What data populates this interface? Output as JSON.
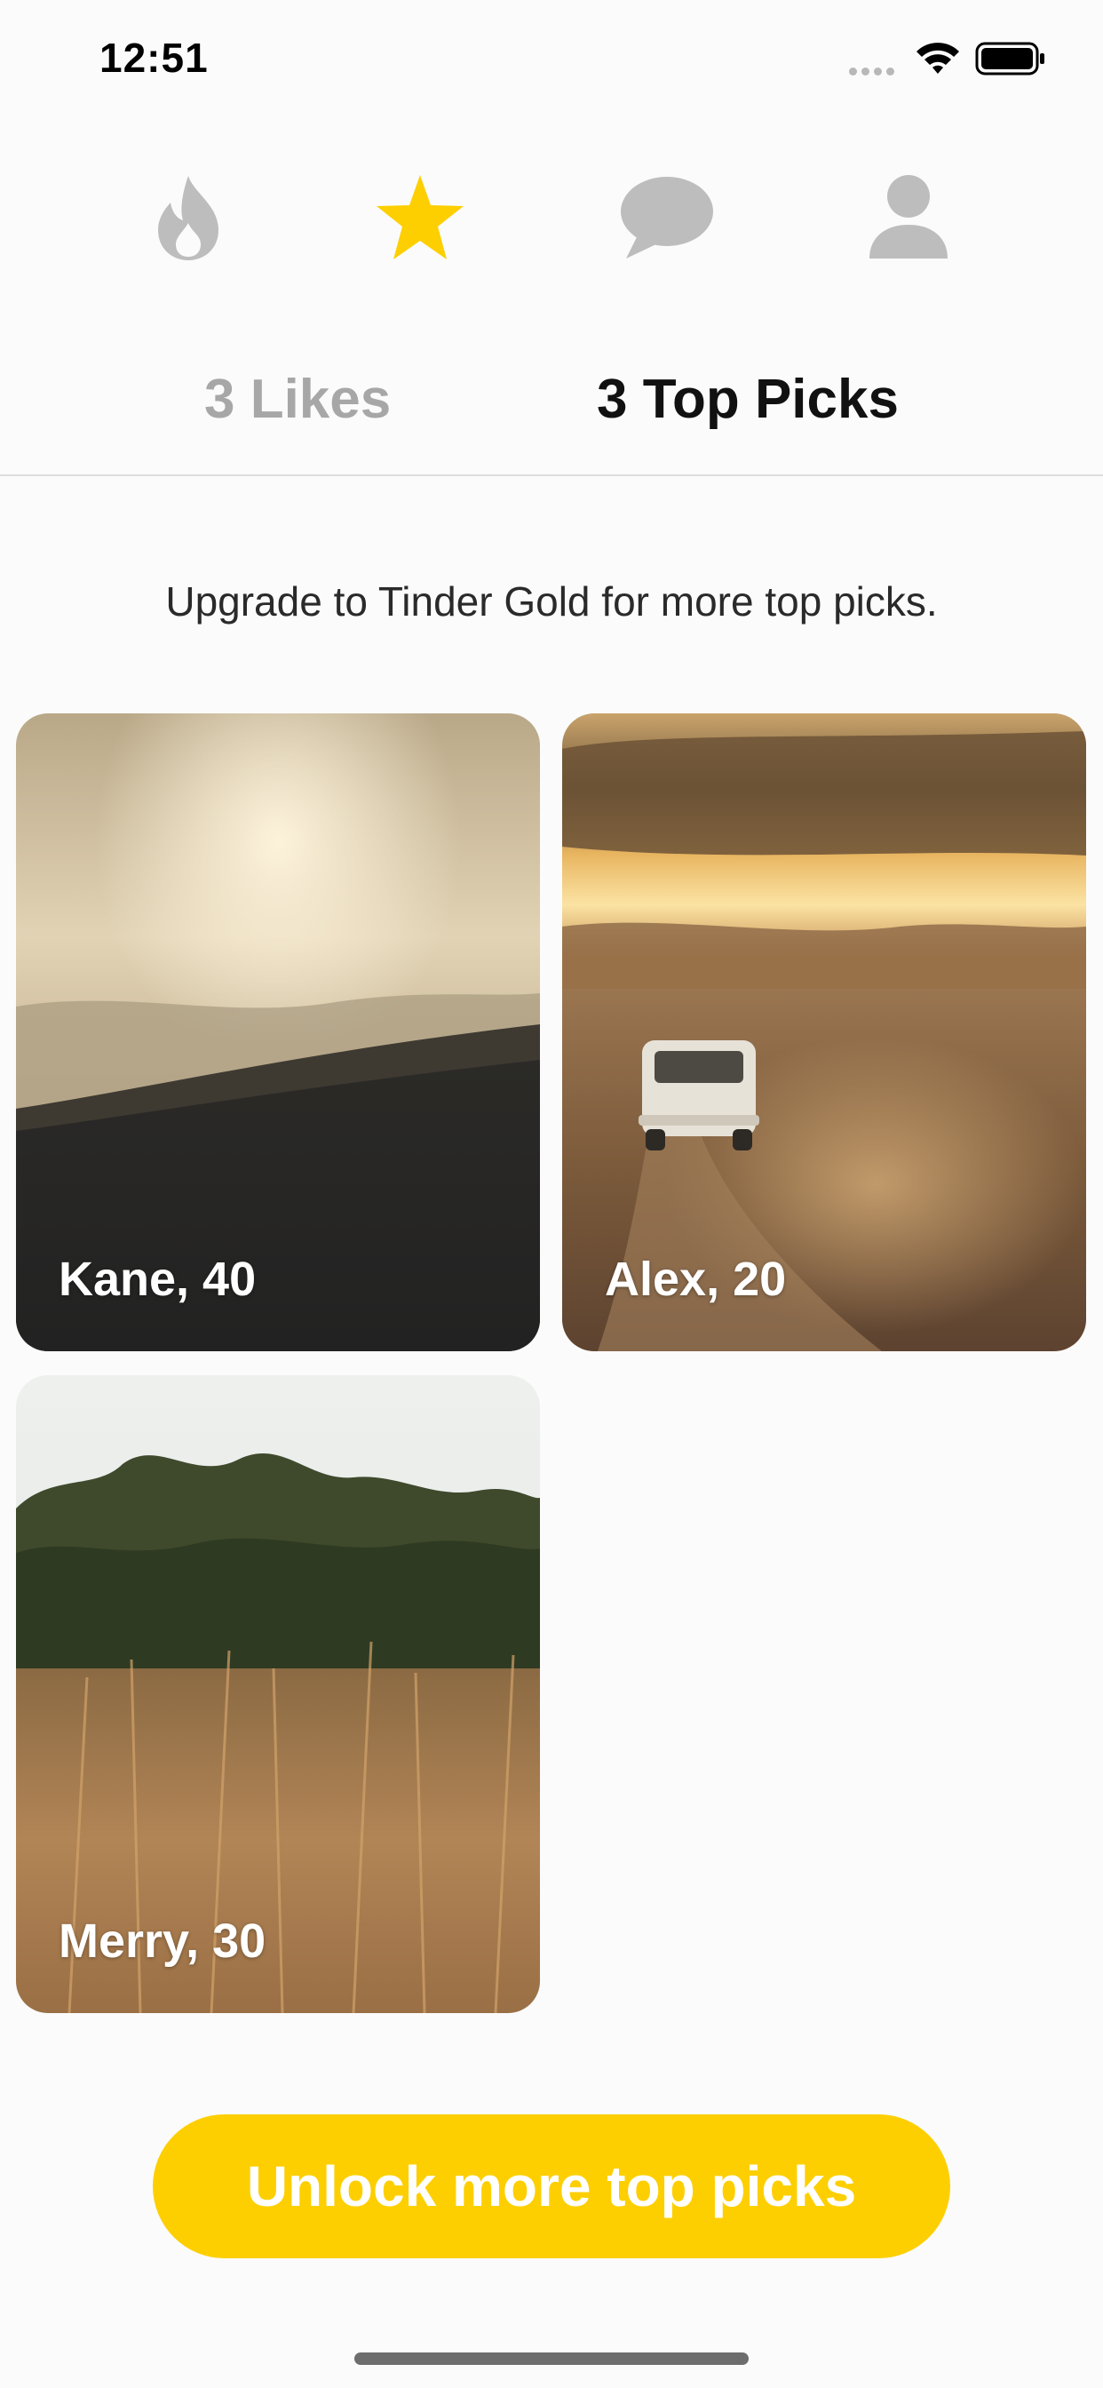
{
  "status_bar": {
    "time": "12:51"
  },
  "nav": {
    "items": [
      {
        "icon": "flame-icon",
        "active": false
      },
      {
        "icon": "star-icon",
        "active": true
      },
      {
        "icon": "chat-bubble-icon",
        "active": false
      },
      {
        "icon": "profile-icon",
        "active": false
      }
    ],
    "active_color": "#fdcf00",
    "inactive_color": "#bdbdbd"
  },
  "tabs": [
    {
      "label": "3 Likes",
      "selected": false
    },
    {
      "label": "3 Top Picks",
      "selected": true
    }
  ],
  "upgrade_message": "Upgrade to Tinder Gold for more top picks.",
  "cards": [
    {
      "label": "Kane, 40"
    },
    {
      "label": "Alex, 20"
    },
    {
      "label": "Merry, 30"
    }
  ],
  "cta": {
    "label": "Unlock more top picks",
    "color": "#fdcf00"
  }
}
